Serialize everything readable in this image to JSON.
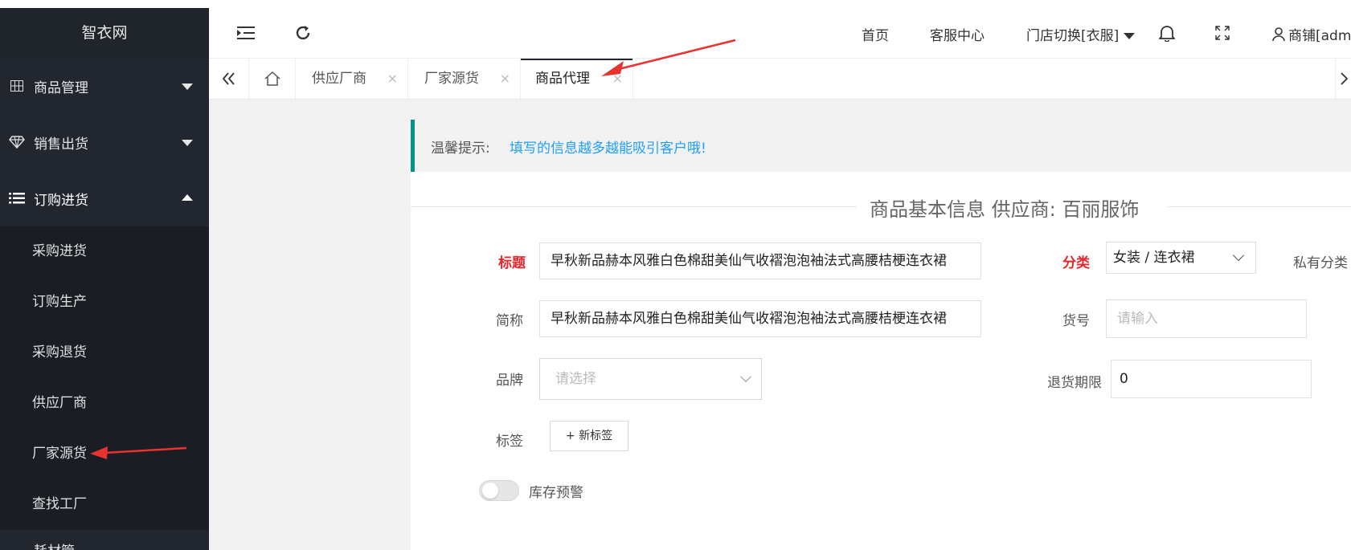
{
  "app": {
    "title": "智衣网"
  },
  "sidebar": {
    "groups": [
      {
        "label": "商品管理",
        "icon": "grid-icon"
      },
      {
        "label": "销售出货",
        "icon": "diamond-icon"
      },
      {
        "label": "订购进货",
        "icon": "list-icon"
      }
    ],
    "submenu": [
      "采购进货",
      "订购生产",
      "采购退货",
      "供应厂商",
      "厂家源货",
      "查找工厂"
    ],
    "partial": "耗材管"
  },
  "header": {
    "nav": [
      "首页",
      "客服中心",
      "门店切换[衣服]"
    ],
    "user": "商铺[adm"
  },
  "tabs": [
    {
      "label": "供应厂商",
      "close": "×"
    },
    {
      "label": "厂家源货",
      "close": "×"
    },
    {
      "label": "商品代理",
      "close": "×"
    }
  ],
  "tip": {
    "label": "温馨提示:",
    "text": "填写的信息越多越能吸引客户哦!"
  },
  "form": {
    "section_title": "商品基本信息 供应商: 百丽服饰",
    "title_label": "标题",
    "title_value": "早秋新品赫本风雅白色棉甜美仙气收褶泡泡袖法式高腰桔梗连衣裙",
    "short_label": "简称",
    "short_value": "早秋新品赫本风雅白色棉甜美仙气收褶泡泡袖法式高腰桔梗连衣裙",
    "brand_label": "品牌",
    "brand_placeholder": "请选择",
    "tag_label": "标签",
    "tag_button": "+ 新标签",
    "stock_label": "库存预警",
    "category_label": "分类",
    "category_value": "女装 / 连衣裙",
    "private_label": "私有分类",
    "sku_label": "货号",
    "sku_placeholder": "请输入",
    "return_label": "退货期限",
    "return_value": "0"
  },
  "colors": {
    "sidebar_bg": "#22262f",
    "accent_teal": "#009688",
    "tip_text": "#1e9fff",
    "required": "#e5262a",
    "annotation_arrow": "#e8332f"
  }
}
